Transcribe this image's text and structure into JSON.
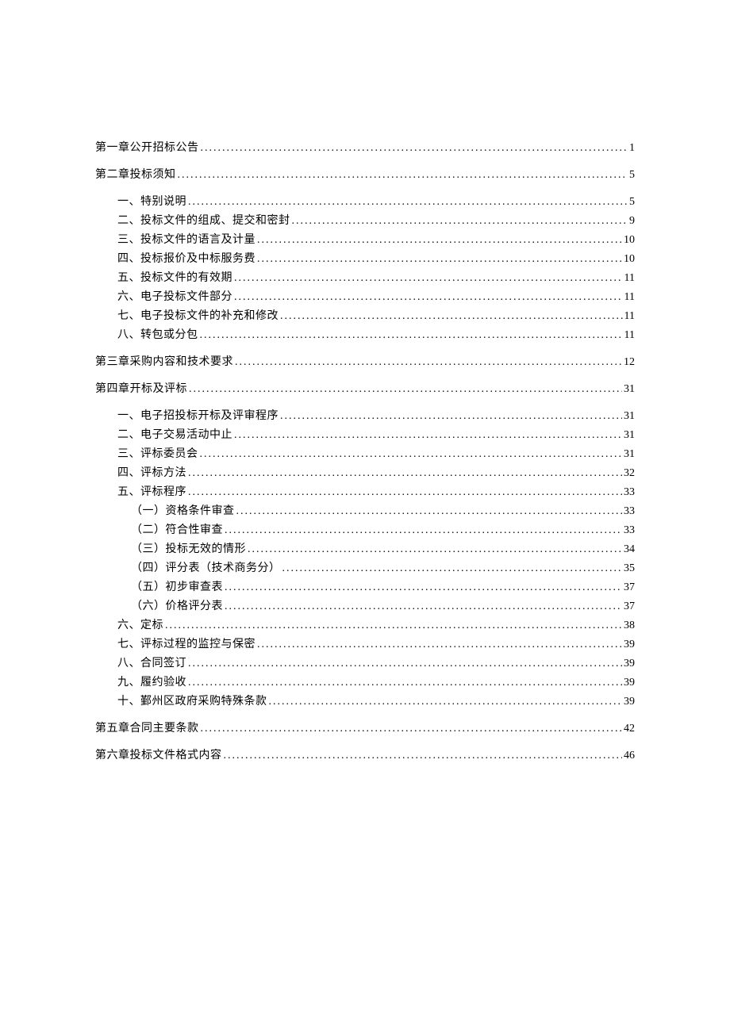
{
  "toc": [
    {
      "level": 1,
      "label": "第一章公开招标公告",
      "page": "1"
    },
    {
      "level": 1,
      "label": "第二章投标须知",
      "page": "5"
    },
    {
      "level": 2,
      "label": "一、特别说明",
      "page": "5"
    },
    {
      "level": 2,
      "label": "二、投标文件的组成、提交和密封",
      "page": "9"
    },
    {
      "level": 2,
      "label": "三、投标文件的语言及计量",
      "page": "10"
    },
    {
      "level": 2,
      "label": "四、投标报价及中标服务费",
      "page": "10"
    },
    {
      "level": 2,
      "label": "五、投标文件的有效期",
      "page": "11"
    },
    {
      "level": 2,
      "label": "六、电子投标文件部分",
      "page": "11"
    },
    {
      "level": 2,
      "label": "七、电子投标文件的补充和修改",
      "page": "11"
    },
    {
      "level": 2,
      "label": "八、转包或分包",
      "page": "11"
    },
    {
      "level": 1,
      "label": "第三章采购内容和技术要求",
      "page": "12"
    },
    {
      "level": 1,
      "label": "第四章开标及评标",
      "page": "31"
    },
    {
      "level": 2,
      "label": "一、电子招投标开标及评审程序",
      "page": "31"
    },
    {
      "level": 2,
      "label": "二、电子交易活动中止",
      "page": "31"
    },
    {
      "level": 2,
      "label": "三、评标委员会",
      "page": "31"
    },
    {
      "level": 2,
      "label": "四、评标方法",
      "page": "32"
    },
    {
      "level": 2,
      "label": "五、评标程序",
      "page": "33"
    },
    {
      "level": 3,
      "label": "（一）资格条件审查",
      "page": "33"
    },
    {
      "level": 3,
      "label": "（二）符合性审查",
      "page": "33"
    },
    {
      "level": 3,
      "label": "（三）投标无效的情形",
      "page": "34"
    },
    {
      "level": 3,
      "label": "（四）评分表（技术商务分）",
      "page": "35"
    },
    {
      "level": 3,
      "label": "（五）初步审查表",
      "page": "37"
    },
    {
      "level": 3,
      "label": "（六）价格评分表",
      "page": "37"
    },
    {
      "level": 2,
      "label": "六、定标",
      "page": "38"
    },
    {
      "level": 2,
      "label": "七、评标过程的监控与保密",
      "page": "39"
    },
    {
      "level": 2,
      "label": "八、合同签订",
      "page": "39"
    },
    {
      "level": 2,
      "label": "九、履约验收",
      "page": "39"
    },
    {
      "level": 2,
      "label": "十、鄞州区政府采购特殊条款",
      "page": "39"
    },
    {
      "level": 1,
      "label": "第五章合同主要条款",
      "page": "42"
    },
    {
      "level": 1,
      "label": "第六章投标文件格式内容",
      "page": "46"
    }
  ]
}
